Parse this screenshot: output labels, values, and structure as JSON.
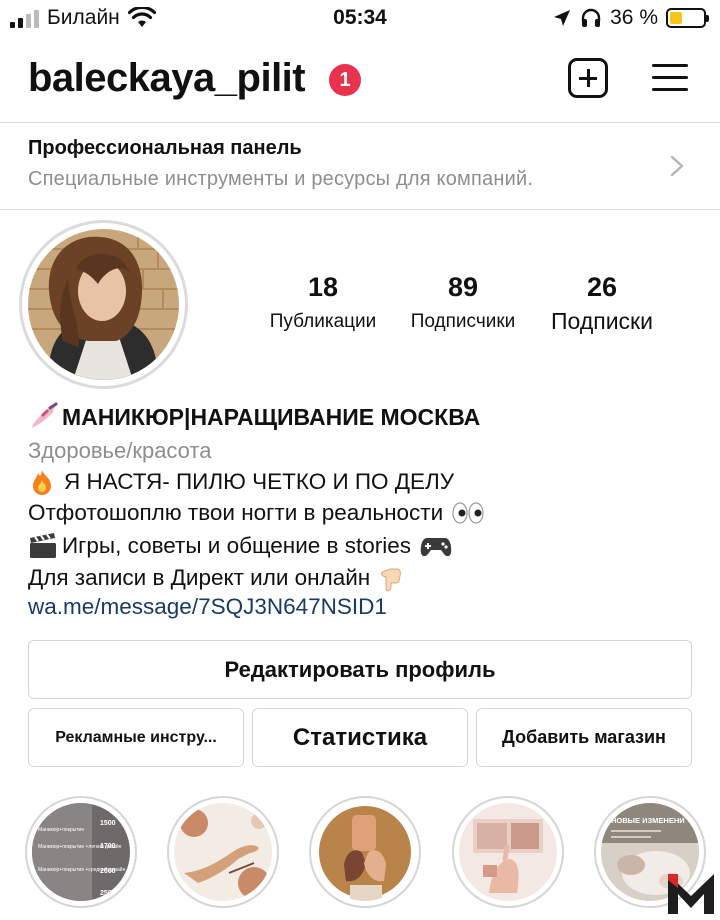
{
  "status_bar": {
    "carrier": "Билайн",
    "time": "05:34",
    "battery_percent": "36 %",
    "battery_level": 0.36
  },
  "header": {
    "username": "baleckaya_pilit",
    "notification_count": "1",
    "icons": [
      "plus-square-icon",
      "menu-icon"
    ]
  },
  "pro_panel": {
    "title": "Профессиональная панель",
    "subtitle": "Специальные инструменты и ресурсы для компаний."
  },
  "stats": [
    {
      "value": "18",
      "label": "Публикации"
    },
    {
      "value": "89",
      "label": "Подписчики"
    },
    {
      "value": "26",
      "label": "Подписки"
    }
  ],
  "bio": {
    "name": "МАНИКЮР|НАРАЩИВАНИЕ МОСКВА",
    "category": "Здоровье/красота",
    "lines": [
      "Я НАСТЯ- ПИЛЮ ЧЕТКО И ПО ДЕЛУ",
      "Отфотошоплю твои ногти в реальности",
      "Игры, советы и общение в stories",
      "Для записи в Директ или онлайн"
    ],
    "link": "wa.me/message/7SQJ3N647NSID1"
  },
  "buttons": {
    "edit_profile": "Редактировать профиль",
    "ads_tools": "Рекламные инстру...",
    "statistics": "Статистика",
    "add_shop": "Добавить магазин"
  },
  "highlights": {
    "price_card": {
      "prices": [
        "1500",
        "1700",
        "2000",
        "2500"
      ],
      "items": [
        "Маникюр+покрытие",
        "Маникюр+покрытие +легкий дизайн",
        "Маникюр+покрытие +средний дизайн"
      ]
    },
    "news_title": "НОВЫЕ ИЗМЕНЕНИ"
  },
  "colors": {
    "badge": "#e8334f",
    "link": "#1a3a66",
    "secondary_text": "#8e8e8e",
    "border": "#d5d5d5"
  }
}
